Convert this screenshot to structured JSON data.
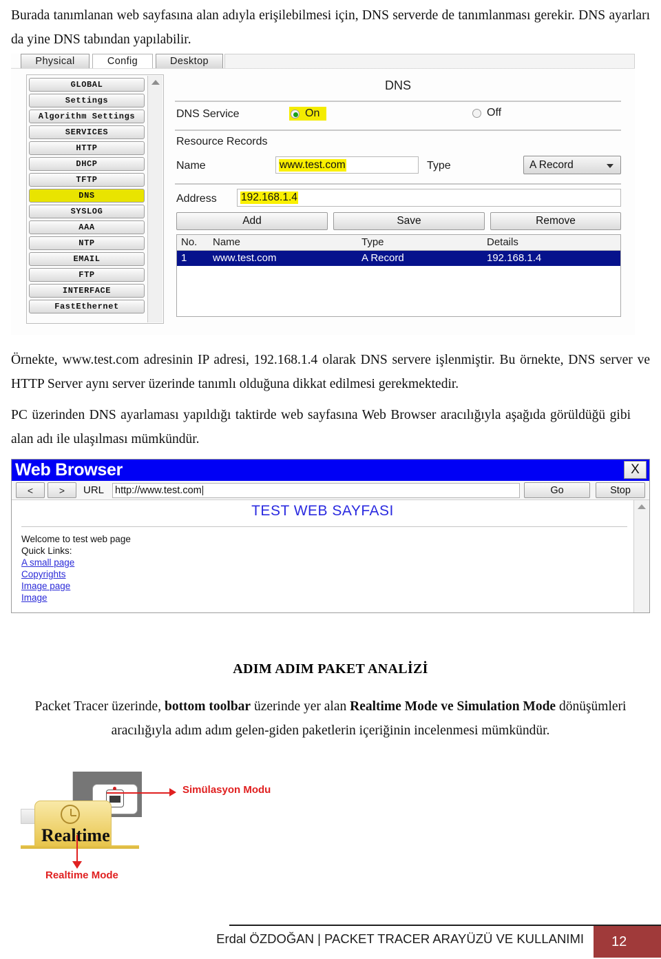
{
  "intro": {
    "text": "Burada tanımlanan web sayfasına alan adıyla erişilebilmesi için, DNS serverde de tanımlanması gerekir. DNS ayarları da yine DNS tabından yapılabilir."
  },
  "dns_window": {
    "tabs": [
      {
        "label": "Physical",
        "selected": false
      },
      {
        "label": "Config",
        "selected": true
      },
      {
        "label": "Desktop",
        "selected": false
      }
    ],
    "sidebar": {
      "items": [
        {
          "label": "GLOBAL",
          "highlighted": false
        },
        {
          "label": "Settings",
          "highlighted": false
        },
        {
          "label": "Algorithm Settings",
          "highlighted": false
        },
        {
          "label": "SERVICES",
          "highlighted": false
        },
        {
          "label": "HTTP",
          "highlighted": false
        },
        {
          "label": "DHCP",
          "highlighted": false
        },
        {
          "label": "TFTP",
          "highlighted": false
        },
        {
          "label": "DNS",
          "highlighted": true
        },
        {
          "label": "SYSLOG",
          "highlighted": false
        },
        {
          "label": "AAA",
          "highlighted": false
        },
        {
          "label": "NTP",
          "highlighted": false
        },
        {
          "label": "EMAIL",
          "highlighted": false
        },
        {
          "label": "FTP",
          "highlighted": false
        },
        {
          "label": "INTERFACE",
          "highlighted": false
        },
        {
          "label": "FastEthernet",
          "highlighted": false
        }
      ]
    },
    "panel": {
      "title": "DNS",
      "service_label": "DNS Service",
      "service_on_label": "On",
      "service_off_label": "Off",
      "service_value": "On",
      "resource_records_label": "Resource Records",
      "name_label": "Name",
      "name_value": "www.test.com",
      "type_label": "Type",
      "type_value": "A Record",
      "address_label": "Address",
      "address_value": "192.168.1.4",
      "buttons": {
        "add": "Add",
        "save": "Save",
        "remove": "Remove"
      },
      "table": {
        "headers": [
          "No.",
          "Name",
          "Type",
          "Details"
        ],
        "rows": [
          {
            "no": "1",
            "name": "www.test.com",
            "type": "A Record",
            "details": "192.168.1.4",
            "selected": true
          }
        ]
      }
    }
  },
  "paragraph_2": {
    "text": "Örnekte, www.test.com adresinin IP adresi, 192.168.1.4 olarak DNS servere işlenmiştir. Bu örnekte, DNS server ve HTTP Server aynı server üzerinde tanımlı olduğuna dikkat edilmesi gerekmektedir."
  },
  "paragraph_3": {
    "text": "PC üzerinden DNS ayarlaması yapıldığı taktirde web sayfasına Web Browser aracılığıyla aşağıda görüldüğü gibi alan adı ile ulaşılması mümkündür."
  },
  "browser": {
    "title": "Web Browser",
    "close_label": "X",
    "back_label": "<",
    "forward_label": ">",
    "url_label": "URL",
    "url_value": "http://www.test.com",
    "go_label": "Go",
    "stop_label": "Stop",
    "page": {
      "heading": "TEST WEB SAYFASI",
      "welcome": "Welcome to test web page",
      "quick_links_label": "Quick Links:",
      "links": [
        "A small page",
        "Copyrights",
        "Image page",
        "Image"
      ]
    }
  },
  "section": {
    "heading": "ADIM ADIM PAKET ANALİZİ",
    "body_part1": "Packet Tracer üzerinde, ",
    "body_bold1": "bottom toolbar",
    "body_part2": " üzerinde yer alan ",
    "body_bold2": "Realtime Mode ve Simulation Mode",
    "body_part3": " dönüşümleri aracılığıyla adım adım gelen-giden paketlerin içeriğinin incelenmesi mümkündür."
  },
  "realtime_figure": {
    "tab_label": "Realtime",
    "annotation_sim": "Simülasyon Modu",
    "annotation_realtime": "Realtime Mode",
    "arrow_color": "#e02020"
  },
  "footer": {
    "text": "Erdal ÖZDOĞAN | PACKET TRACER ARAYÜZÜ VE KULLANIMI",
    "page_number": "12",
    "page_box_color": "#a03a3a"
  }
}
